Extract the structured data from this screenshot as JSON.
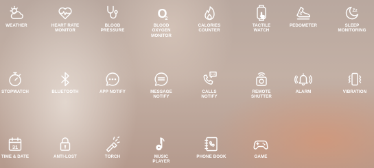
{
  "features": [
    {
      "label": "WEATHER",
      "icon": "weather-icon"
    },
    {
      "label": "HEART RATE\nMONITOR",
      "icon": "heart-rate-icon"
    },
    {
      "label": "BLOOD\nPRESSURE",
      "icon": "stethoscope-icon"
    },
    {
      "label": "BLOOD\nOXYGEN\nMONITOR",
      "icon": "oxygen-icon",
      "glyph": "O",
      "sub": "2"
    },
    {
      "label": "CALORIES\nCOUNTER",
      "icon": "flame-icon"
    },
    {
      "label": "TACTILE\nWATCH",
      "icon": "watch-touch-icon"
    },
    {
      "label": "PEDOMETER",
      "icon": "running-shoe-icon"
    },
    {
      "label": "SLEEP\nMONITORING",
      "icon": "sleep-moon-icon",
      "glyph": "Zz"
    },
    {
      "label": "STOPWATCH",
      "icon": "stopwatch-icon"
    },
    {
      "label": "BLUETOOTH",
      "icon": "bluetooth-icon"
    },
    {
      "label": "APP NOTIFY",
      "icon": "chat-dots-icon"
    },
    {
      "label": "MESSAGE\nNOTIFY",
      "icon": "message-icon"
    },
    {
      "label": "CALLS\nNOTIFY",
      "icon": "phone-call-icon"
    },
    {
      "label": "REMOTE\nSHUTTER",
      "icon": "remote-camera-icon"
    },
    {
      "label": "ALARM",
      "icon": "alarm-bell-icon"
    },
    {
      "label": "VIBRATION",
      "icon": "vibration-icon"
    },
    {
      "label": "TIME & DATE",
      "icon": "calendar-icon",
      "glyph": "31"
    },
    {
      "label": "ANTI-LOST",
      "icon": "padlock-icon"
    },
    {
      "label": "TORCH",
      "icon": "torch-icon"
    },
    {
      "label": "MUSIC\nPLAYER",
      "icon": "music-note-icon"
    },
    {
      "label": "PHONE BOOK",
      "icon": "phone-book-icon"
    },
    {
      "label": "GAME",
      "icon": "gamepad-icon"
    }
  ]
}
